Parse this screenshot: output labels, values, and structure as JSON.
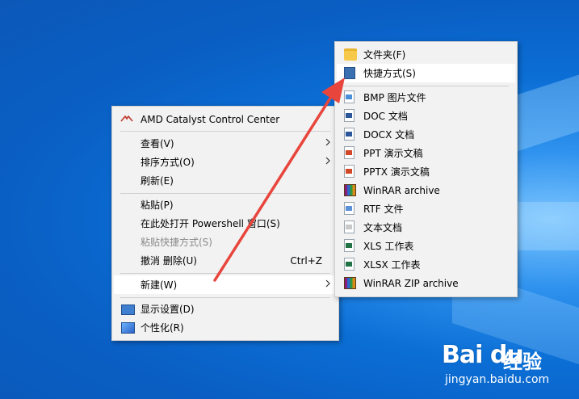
{
  "context_menu": {
    "items": [
      {
        "label": "AMD Catalyst Control Center"
      },
      {
        "label": "查看(V)"
      },
      {
        "label": "排序方式(O)"
      },
      {
        "label": "刷新(E)"
      },
      {
        "label": "粘贴(P)"
      },
      {
        "label": "在此处打开 Powershell 窗口(S)"
      },
      {
        "label": "粘贴快捷方式(S)"
      },
      {
        "label": "撤消 删除(U)",
        "shortcut": "Ctrl+Z"
      },
      {
        "label": "新建(W)"
      },
      {
        "label": "显示设置(D)"
      },
      {
        "label": "个性化(R)"
      }
    ]
  },
  "new_submenu": {
    "items": [
      {
        "label": "文件夹(F)"
      },
      {
        "label": "快捷方式(S)"
      },
      {
        "label": "BMP 图片文件"
      },
      {
        "label": "DOC 文档"
      },
      {
        "label": "DOCX 文档"
      },
      {
        "label": "PPT 演示文稿"
      },
      {
        "label": "PPTX 演示文稿"
      },
      {
        "label": "WinRAR archive"
      },
      {
        "label": "RTF 文件"
      },
      {
        "label": "文本文档"
      },
      {
        "label": "XLS 工作表"
      },
      {
        "label": "XLSX 工作表"
      },
      {
        "label": "WinRAR ZIP archive"
      }
    ]
  },
  "watermark": {
    "logo": "Bai du",
    "brand": "经验",
    "url": "jingyan.baidu.com"
  },
  "colors": {
    "menu_bg": "#f2f2f2",
    "highlight": "#ffffff",
    "arrow": "#e8453c",
    "desktop_blue": "#0b6fd6"
  }
}
